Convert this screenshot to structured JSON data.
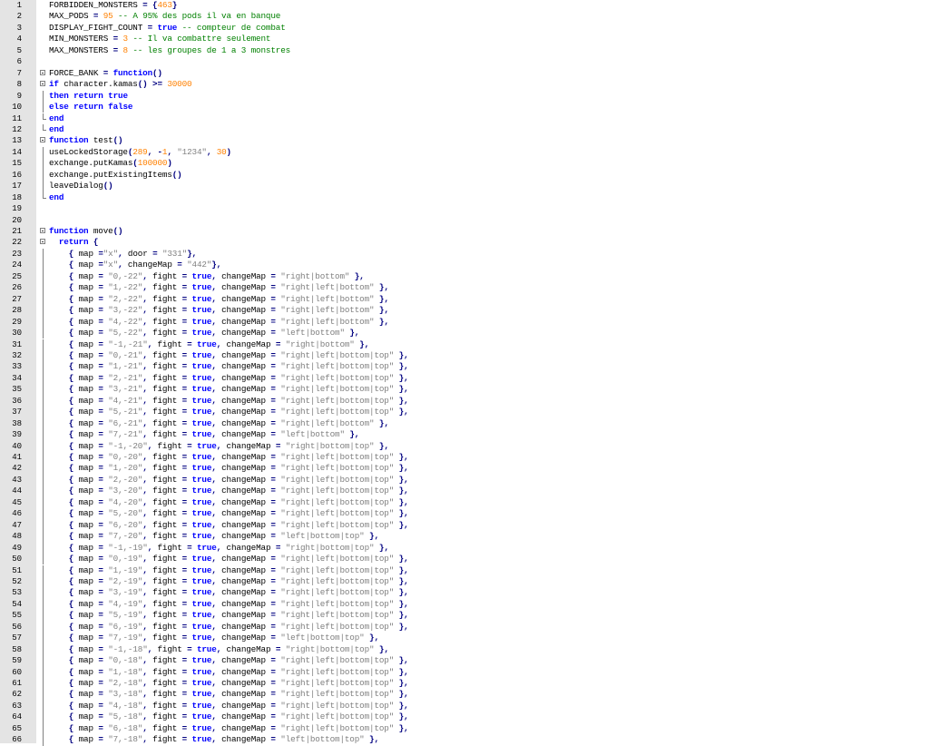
{
  "editor": {
    "gutter_color": "#e4e4e4",
    "start_line": 1,
    "lines": [
      {
        "n": "1",
        "fold": "",
        "tokens": [
          [
            "p",
            "FORBIDDEN_MONSTERS "
          ],
          [
            "o",
            "="
          ],
          [
            "p",
            " "
          ],
          [
            "o",
            "{"
          ],
          [
            "n",
            "463"
          ],
          [
            "o",
            "}"
          ]
        ]
      },
      {
        "n": "2",
        "fold": "",
        "tokens": [
          [
            "p",
            "MAX_PODS "
          ],
          [
            "o",
            "="
          ],
          [
            "p",
            " "
          ],
          [
            "n",
            "95"
          ],
          [
            "p",
            " "
          ],
          [
            "c",
            "-- A 95% des pods il va en banque"
          ]
        ]
      },
      {
        "n": "3",
        "fold": "",
        "tokens": [
          [
            "p",
            "DISPLAY_FIGHT_COUNT "
          ],
          [
            "o",
            "="
          ],
          [
            "p",
            " "
          ],
          [
            "k",
            "true"
          ],
          [
            "p",
            " "
          ],
          [
            "c",
            "-- compteur de combat"
          ]
        ]
      },
      {
        "n": "4",
        "fold": "",
        "tokens": [
          [
            "p",
            "MIN_MONSTERS "
          ],
          [
            "o",
            "="
          ],
          [
            "p",
            " "
          ],
          [
            "n",
            "3"
          ],
          [
            "p",
            " "
          ],
          [
            "c",
            "-- Il va combattre seulement"
          ]
        ]
      },
      {
        "n": "5",
        "fold": "",
        "tokens": [
          [
            "p",
            "MAX_MONSTERS "
          ],
          [
            "o",
            "="
          ],
          [
            "p",
            " "
          ],
          [
            "n",
            "8"
          ],
          [
            "p",
            " "
          ],
          [
            "c",
            "-- les groupes de 1 a 3 monstres"
          ]
        ]
      },
      {
        "n": "6",
        "fold": "",
        "tokens": []
      },
      {
        "n": "7",
        "fold": "open",
        "tokens": [
          [
            "p",
            "FORCE_BANK "
          ],
          [
            "o",
            "="
          ],
          [
            "p",
            " "
          ],
          [
            "k",
            "function"
          ],
          [
            "o",
            "()"
          ]
        ]
      },
      {
        "n": "8",
        "fold": "open",
        "tokens": [
          [
            "k",
            "if"
          ],
          [
            "p",
            " character.kamas"
          ],
          [
            "o",
            "()"
          ],
          [
            "p",
            " "
          ],
          [
            "o",
            ">="
          ],
          [
            "p",
            " "
          ],
          [
            "n",
            "30000"
          ]
        ]
      },
      {
        "n": "9",
        "fold": "line",
        "tokens": [
          [
            "k",
            "then"
          ],
          [
            "p",
            " "
          ],
          [
            "k",
            "return"
          ],
          [
            "p",
            " "
          ],
          [
            "k",
            "true"
          ]
        ]
      },
      {
        "n": "10",
        "fold": "line",
        "tokens": [
          [
            "k",
            "else"
          ],
          [
            "p",
            " "
          ],
          [
            "k",
            "return"
          ],
          [
            "p",
            " "
          ],
          [
            "k",
            "false"
          ]
        ]
      },
      {
        "n": "11",
        "fold": "end",
        "tokens": [
          [
            "k",
            "end"
          ]
        ]
      },
      {
        "n": "12",
        "fold": "end",
        "tokens": [
          [
            "k",
            "end"
          ]
        ]
      },
      {
        "n": "13",
        "fold": "open",
        "tokens": [
          [
            "k",
            "function"
          ],
          [
            "p",
            " test"
          ],
          [
            "o",
            "()"
          ]
        ]
      },
      {
        "n": "14",
        "fold": "line",
        "tokens": [
          [
            "p",
            "useLockedStorage"
          ],
          [
            "o",
            "("
          ],
          [
            "n",
            "289"
          ],
          [
            "o",
            ","
          ],
          [
            "p",
            " "
          ],
          [
            "o",
            "-"
          ],
          [
            "n",
            "1"
          ],
          [
            "o",
            ","
          ],
          [
            "p",
            " "
          ],
          [
            "s",
            "\"1234\""
          ],
          [
            "o",
            ","
          ],
          [
            "p",
            " "
          ],
          [
            "n",
            "30"
          ],
          [
            "o",
            ")"
          ]
        ]
      },
      {
        "n": "15",
        "fold": "line",
        "tokens": [
          [
            "p",
            "exchange.putKamas"
          ],
          [
            "o",
            "("
          ],
          [
            "n",
            "100000"
          ],
          [
            "o",
            ")"
          ]
        ]
      },
      {
        "n": "16",
        "fold": "line",
        "tokens": [
          [
            "p",
            "exchange.putExistingItems"
          ],
          [
            "o",
            "()"
          ]
        ]
      },
      {
        "n": "17",
        "fold": "line",
        "tokens": [
          [
            "p",
            "leaveDialog"
          ],
          [
            "o",
            "()"
          ]
        ]
      },
      {
        "n": "18",
        "fold": "end",
        "tokens": [
          [
            "k",
            "end"
          ]
        ]
      },
      {
        "n": "19",
        "fold": "",
        "tokens": []
      },
      {
        "n": "20",
        "fold": "",
        "tokens": []
      },
      {
        "n": "21",
        "fold": "open",
        "tokens": [
          [
            "k",
            "function"
          ],
          [
            "p",
            " move"
          ],
          [
            "o",
            "()"
          ]
        ]
      },
      {
        "n": "22",
        "fold": "open",
        "tokens": [
          [
            "p",
            "  "
          ],
          [
            "k",
            "return"
          ],
          [
            "p",
            " "
          ],
          [
            "o",
            "{"
          ]
        ]
      },
      {
        "n": "23",
        "fold": "line",
        "tokens": [
          [
            "p",
            "    "
          ],
          [
            "o",
            "{"
          ],
          [
            "p",
            " map "
          ],
          [
            "o",
            "="
          ],
          [
            "s",
            "\"x\""
          ],
          [
            "o",
            ","
          ],
          [
            "p",
            " door "
          ],
          [
            "o",
            "="
          ],
          [
            "p",
            " "
          ],
          [
            "s",
            "\"331\""
          ],
          [
            "o",
            "},"
          ]
        ]
      },
      {
        "n": "24",
        "fold": "line",
        "tokens": [
          [
            "p",
            "    "
          ],
          [
            "o",
            "{"
          ],
          [
            "p",
            " map "
          ],
          [
            "o",
            "="
          ],
          [
            "s",
            "\"x\""
          ],
          [
            "o",
            ","
          ],
          [
            "p",
            " changeMap "
          ],
          [
            "o",
            "="
          ],
          [
            "p",
            " "
          ],
          [
            "s",
            "\"442\""
          ],
          [
            "o",
            "},"
          ]
        ]
      },
      {
        "n": "25",
        "fold": "line",
        "m": "0,-22",
        "f": "true",
        "c": "right|bottom"
      },
      {
        "n": "26",
        "fold": "line",
        "m": "1,-22",
        "f": "true",
        "c": "right|left|bottom"
      },
      {
        "n": "27",
        "fold": "line",
        "m": "2,-22",
        "f": "true",
        "c": "right|left|bottom"
      },
      {
        "n": "28",
        "fold": "line",
        "m": "3,-22",
        "f": "true",
        "c": "right|left|bottom"
      },
      {
        "n": "29",
        "fold": "line",
        "m": "4,-22",
        "f": "true",
        "c": "right|left|bottom"
      },
      {
        "n": "30",
        "fold": "line",
        "m": "5,-22",
        "f": "true",
        "c": "left|bottom"
      },
      {
        "n": "31",
        "fold": "line",
        "m": "-1,-21",
        "f": "true",
        "c": "right|bottom"
      },
      {
        "n": "32",
        "fold": "line",
        "m": "0,-21",
        "f": "true",
        "c": "right|left|bottom|top"
      },
      {
        "n": "33",
        "fold": "line",
        "m": "1,-21",
        "f": "true",
        "c": "right|left|bottom|top"
      },
      {
        "n": "34",
        "fold": "line",
        "m": "2,-21",
        "f": "true",
        "c": "right|left|bottom|top"
      },
      {
        "n": "35",
        "fold": "line",
        "m": "3,-21",
        "f": "true",
        "c": "right|left|bottom|top"
      },
      {
        "n": "36",
        "fold": "line",
        "m": "4,-21",
        "f": "true",
        "c": "right|left|bottom|top"
      },
      {
        "n": "37",
        "fold": "line",
        "m": "5,-21",
        "f": "true",
        "c": "right|left|bottom|top"
      },
      {
        "n": "38",
        "fold": "line",
        "m": "6,-21",
        "f": "true",
        "c": "right|left|bottom"
      },
      {
        "n": "39",
        "fold": "line",
        "m": "7,-21",
        "f": "true",
        "c": "left|bottom"
      },
      {
        "n": "40",
        "fold": "line",
        "m": "-1,-20",
        "f": "true",
        "c": "right|bottom|top"
      },
      {
        "n": "41",
        "fold": "line",
        "m": "0,-20",
        "f": "true",
        "c": "right|left|bottom|top"
      },
      {
        "n": "42",
        "fold": "line",
        "m": "1,-20",
        "f": "true",
        "c": "right|left|bottom|top"
      },
      {
        "n": "43",
        "fold": "line",
        "m": "2,-20",
        "f": "true",
        "c": "right|left|bottom|top"
      },
      {
        "n": "44",
        "fold": "line",
        "m": "3,-20",
        "f": "true",
        "c": "right|left|bottom|top"
      },
      {
        "n": "45",
        "fold": "line",
        "m": "4,-20",
        "f": "true",
        "c": "right|left|bottom|top"
      },
      {
        "n": "46",
        "fold": "line",
        "m": "5,-20",
        "f": "true",
        "c": "right|left|bottom|top"
      },
      {
        "n": "47",
        "fold": "line",
        "m": "6,-20",
        "f": "true",
        "c": "right|left|bottom|top"
      },
      {
        "n": "48",
        "fold": "line",
        "m": "7,-20",
        "f": "true",
        "c": "left|bottom|top"
      },
      {
        "n": "49",
        "fold": "line",
        "m": "-1,-19",
        "f": "true",
        "c": "right|bottom|top"
      },
      {
        "n": "50",
        "fold": "line",
        "m": "0,-19",
        "f": "true",
        "c": "right|left|bottom|top"
      },
      {
        "n": "51",
        "fold": "line",
        "m": "1,-19",
        "f": "true",
        "c": "right|left|bottom|top"
      },
      {
        "n": "52",
        "fold": "line",
        "m": "2,-19",
        "f": "true",
        "c": "right|left|bottom|top"
      },
      {
        "n": "53",
        "fold": "line",
        "m": "3,-19",
        "f": "true",
        "c": "right|left|bottom|top"
      },
      {
        "n": "54",
        "fold": "line",
        "m": "4,-19",
        "f": "true",
        "c": "right|left|bottom|top"
      },
      {
        "n": "55",
        "fold": "line",
        "m": "5,-19",
        "f": "true",
        "c": "right|left|bottom|top"
      },
      {
        "n": "56",
        "fold": "line",
        "m": "6,-19",
        "f": "true",
        "c": "right|left|bottom|top"
      },
      {
        "n": "57",
        "fold": "line",
        "m": "7,-19",
        "f": "true",
        "c": "left|bottom|top"
      },
      {
        "n": "58",
        "fold": "line",
        "m": "-1,-18",
        "f": "true",
        "c": "right|bottom|top"
      },
      {
        "n": "59",
        "fold": "line",
        "m": "0,-18",
        "f": "true",
        "c": "right|left|bottom|top"
      },
      {
        "n": "60",
        "fold": "line",
        "m": "1,-18",
        "f": "true",
        "c": "right|left|bottom|top"
      },
      {
        "n": "61",
        "fold": "line",
        "m": "2,-18",
        "f": "true",
        "c": "right|left|bottom|top"
      },
      {
        "n": "62",
        "fold": "line",
        "m": "3,-18",
        "f": "true",
        "c": "right|left|bottom|top"
      },
      {
        "n": "63",
        "fold": "line",
        "m": "4,-18",
        "f": "true",
        "c": "right|left|bottom|top"
      },
      {
        "n": "64",
        "fold": "line",
        "m": "5,-18",
        "f": "true",
        "c": "right|left|bottom|top"
      },
      {
        "n": "65",
        "fold": "line",
        "m": "6,-18",
        "f": "true",
        "c": "right|left|bottom|top"
      },
      {
        "n": "66",
        "fold": "line",
        "m": "7,-18",
        "f": "true",
        "c": "left|bottom|top"
      }
    ]
  }
}
